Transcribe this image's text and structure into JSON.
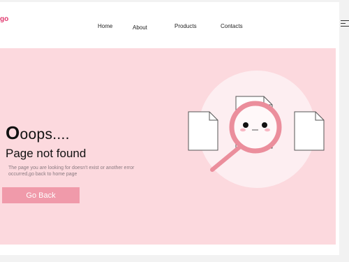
{
  "header": {
    "logo_text": "go",
    "nav": [
      "Home",
      "About",
      "Products",
      "Contacts"
    ],
    "menu_icon": "hamburger-menu-icon"
  },
  "hero": {
    "headline_big": "O",
    "headline_rest": "oops....",
    "subtitle": "Page not found",
    "description": "The page you are looking for doesn't exist or another error occurred,go back to home page",
    "button_label": "Go Back",
    "illustration": "magnifier-404-icon"
  },
  "colors": {
    "accent": "#e0386e",
    "hero_bg": "#fcd9de",
    "button_bg": "#f09aaa",
    "magnifier": "#eb8e9c"
  }
}
